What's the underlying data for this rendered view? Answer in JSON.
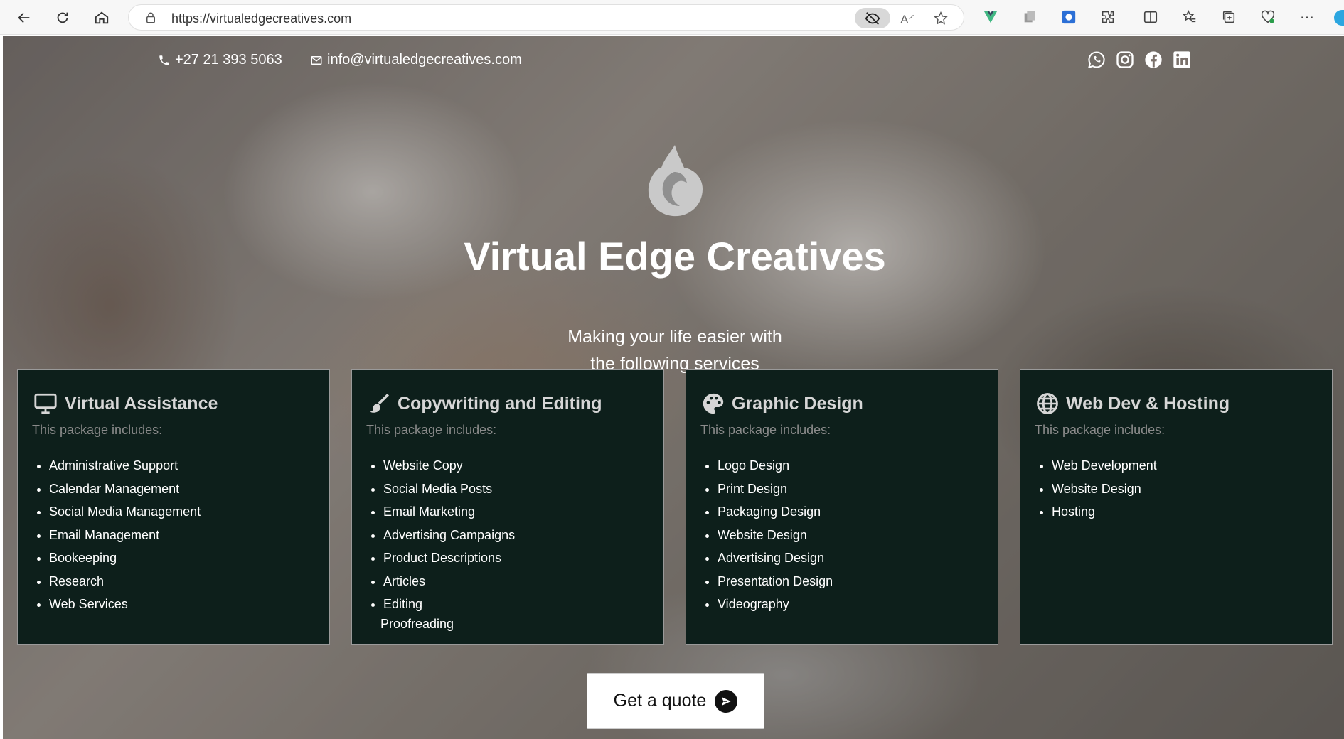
{
  "browser": {
    "url": "https://virtualedgecreatives.com"
  },
  "topbar": {
    "phone": "+27 21 393 5063",
    "email": "info@virtualedgecreatives.com",
    "socials": [
      "whatsapp-icon",
      "instagram-icon",
      "facebook-icon",
      "linkedin-icon"
    ]
  },
  "hero": {
    "title": "Virtual Edge Creatives",
    "subtitle_line1": "Making your life easier with",
    "subtitle_line2": "the following services"
  },
  "cards": [
    {
      "icon": "monitor-icon",
      "title": "Virtual Assistance",
      "sub": "This package includes:",
      "items": [
        "Administrative Support",
        "Calendar Management",
        "Social Media Management",
        "Email Management",
        "Bookeeping",
        "Research",
        "Web Services"
      ]
    },
    {
      "icon": "brush-icon",
      "title": "Copywriting and Editing",
      "sub": "This package includes:",
      "items": [
        "Website Copy",
        "Social Media Posts",
        "Email Marketing",
        "Advertising Campaigns",
        "Product Descriptions",
        "Articles",
        "Editing"
      ],
      "extra": "Proofreading"
    },
    {
      "icon": "palette-icon",
      "title": "Graphic Design",
      "sub": "This package includes:",
      "items": [
        "Logo Design",
        "Print Design",
        "Packaging Design",
        "Website Design",
        "Advertising Design",
        "Presentation Design",
        "Videography"
      ]
    },
    {
      "icon": "globe-icon",
      "title": "Web Dev & Hosting",
      "sub": "This package includes:",
      "items": [
        "Web Development",
        "Website Design",
        "Hosting"
      ]
    }
  ],
  "cta": {
    "label": "Get a quote"
  },
  "colors": {
    "card_bg": "#0d1f1b",
    "text": "#ffffff",
    "muted": "#8b8b8b"
  }
}
